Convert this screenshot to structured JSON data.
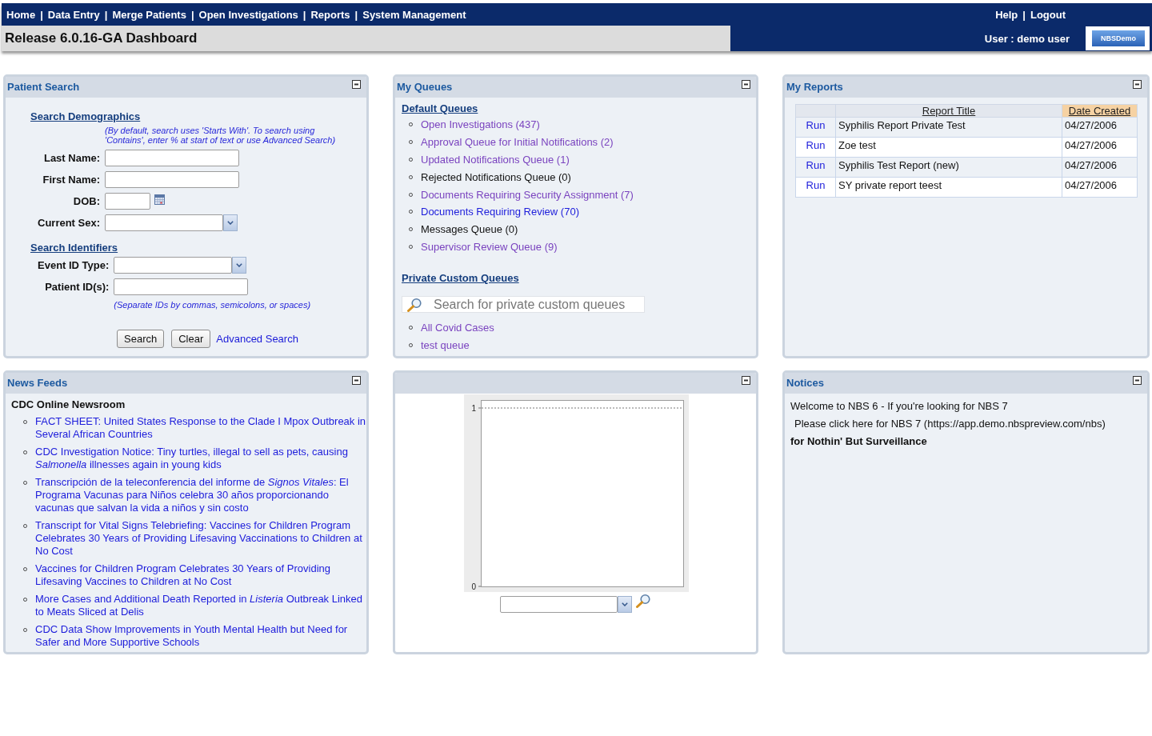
{
  "header": {
    "nav": [
      {
        "label": "Home"
      },
      {
        "label": "Data Entry"
      },
      {
        "label": "Merge Patients"
      },
      {
        "label": "Open Investigations"
      },
      {
        "label": "Reports"
      },
      {
        "label": "System Management"
      }
    ],
    "separator": "|",
    "utility_links": [
      {
        "label": "Help"
      },
      {
        "label": "Logout"
      }
    ],
    "page_title": "Release 6.0.16-GA Dashboard",
    "user": "User : demo user",
    "logo": "NBSDemo"
  },
  "patient_search": {
    "title": "Patient Search",
    "sections": [
      {
        "heading": "Search Demographics",
        "note": "(By default, search uses 'Starts With'. To search using 'Contains', enter % at start of text or use Advanced Search)",
        "fields": [
          {
            "label": "Last Name:",
            "kind": "text"
          },
          {
            "label": "First Name:",
            "kind": "text"
          },
          {
            "label": "DOB:",
            "kind": "date"
          },
          {
            "label": "Current Sex:",
            "kind": "select"
          }
        ]
      },
      {
        "heading": "Search Identifiers",
        "fields": [
          {
            "label": "Event ID Type:",
            "kind": "select"
          },
          {
            "label": "Patient ID(s):",
            "kind": "text"
          }
        ],
        "footnote": "(Separate IDs by commas, semicolons, or spaces)"
      }
    ],
    "buttons": [
      "Search",
      "Clear"
    ],
    "link": "Advanced Search"
  },
  "my_queues": {
    "title": "My Queues",
    "groups": [
      {
        "heading": "Default Queues",
        "items": [
          {
            "label": "Open Investigations (437)",
            "kind": "visited"
          },
          {
            "label": "Approval Queue for Initial Notifications (2)",
            "kind": "visited"
          },
          {
            "label": "Updated Notifications Queue (1)",
            "kind": "visited"
          },
          {
            "label": "Rejected Notifications Queue (0)",
            "kind": "plain"
          },
          {
            "label": "Documents Requiring Security Assignment (7)",
            "kind": "visited"
          },
          {
            "label": "Documents Requiring Review (70)",
            "kind": "link"
          },
          {
            "label": "Messages Queue (0)",
            "kind": "plain"
          },
          {
            "label": "Supervisor Review Queue (9)",
            "kind": "visited"
          }
        ]
      },
      {
        "heading": "Private Custom Queues",
        "search": {
          "placeholder": "Search for private custom queues"
        },
        "items": [
          {
            "label": "All Covid Cases",
            "kind": "visited"
          },
          {
            "label": "test queue",
            "kind": "visited"
          }
        ]
      }
    ]
  },
  "my_reports": {
    "title": "My Reports",
    "columns": [
      {
        "label": "Report Title",
        "sorted": false
      },
      {
        "label": "Date Created",
        "sorted": true
      }
    ],
    "rows": [
      {
        "action": "Run",
        "title": "Syphilis Report Private Test",
        "date": "04/27/2006"
      },
      {
        "action": "Run",
        "title": "Zoe test",
        "date": "04/27/2006"
      },
      {
        "action": "Run",
        "title": "Syphilis Test Report (new)",
        "date": "04/27/2006"
      },
      {
        "action": "Run",
        "title": "SY private report teest",
        "date": "04/27/2006"
      }
    ]
  },
  "news_feeds": {
    "title": "News Feeds",
    "source": "CDC Online Newsroom",
    "items": [
      "FACT SHEET: United States Response to the Clade I Mpox Outbreak in Several African Countries",
      "CDC Investigation Notice: Tiny turtles, illegal to sell as pets, causing *Salmonella* illnesses again in young kids",
      "Transcripción de la teleconferencia del informe de *Signos Vitales*: El Programa Vacunas para Niños celebra 30 años proporcionando vacunas que salvan la vida a niños y sin costo",
      "Transcript for Vital Signs Telebriefing: Vaccines for Children Program Celebrates 30 Years of Providing Lifesaving Vaccinations to Children at No Cost",
      "Vaccines for Children Program Celebrates 30 Years of Providing Lifesaving Vaccines to Children at No Cost",
      "More Cases and Additional Death Reported in *Listeria* Outbreak Linked to Meats Sliced at Delis",
      "CDC Data Show Improvements in Youth Mental Health but Need for Safer and More Supportive Schools"
    ]
  },
  "chart_panel": {
    "y_axis_labels": [
      "1",
      "0"
    ]
  },
  "notices": {
    "title": "Notices",
    "lines": [
      {
        "text": "Welcome to NBS 6 - If you're looking for NBS 7",
        "bold": false,
        "indented": false
      },
      {
        "text": "Please click here for NBS 7 (https://app.demo.nbspreview.com/nbs)",
        "bold": false,
        "indented": true
      },
      {
        "text": "for Nothin' But Surveillance",
        "bold": true,
        "indented": false
      }
    ]
  }
}
